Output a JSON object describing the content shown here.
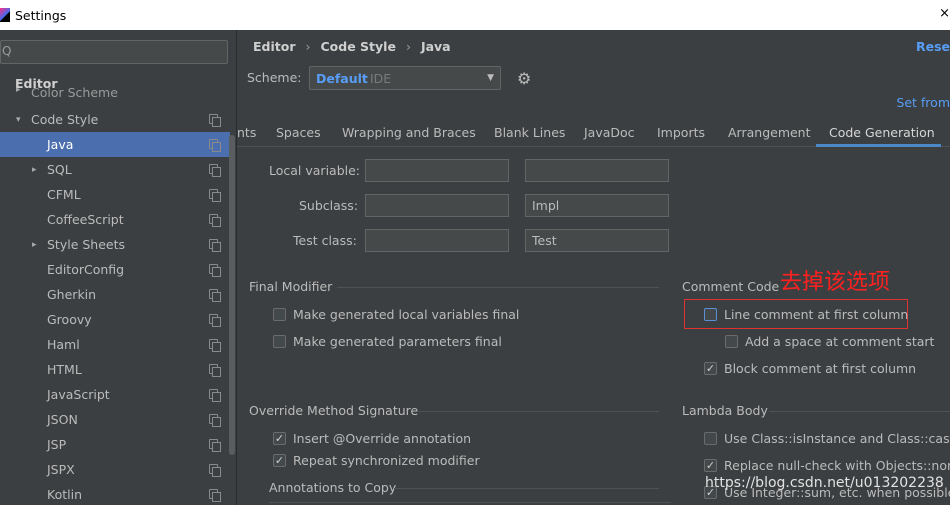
{
  "window": {
    "title": "Settings",
    "close_glyph": "×"
  },
  "sidebar": {
    "search_icon": "Q",
    "search_value": "",
    "section_title": "Editor",
    "items": [
      {
        "label": "Color Scheme",
        "arrow": "▸"
      },
      {
        "label": "Code Style",
        "arrow": "▾"
      },
      {
        "label": "Java",
        "arrow": ""
      },
      {
        "label": "SQL",
        "arrow": "▸"
      },
      {
        "label": "CFML",
        "arrow": ""
      },
      {
        "label": "CoffeeScript",
        "arrow": ""
      },
      {
        "label": "Style Sheets",
        "arrow": "▸"
      },
      {
        "label": "EditorConfig",
        "arrow": ""
      },
      {
        "label": "Gherkin",
        "arrow": ""
      },
      {
        "label": "Groovy",
        "arrow": ""
      },
      {
        "label": "Haml",
        "arrow": ""
      },
      {
        "label": "HTML",
        "arrow": ""
      },
      {
        "label": "JavaScript",
        "arrow": ""
      },
      {
        "label": "JSON",
        "arrow": ""
      },
      {
        "label": "JSP",
        "arrow": ""
      },
      {
        "label": "JSPX",
        "arrow": ""
      },
      {
        "label": "Kotlin",
        "arrow": ""
      }
    ]
  },
  "header": {
    "breadcrumb": [
      "Editor",
      "Code Style",
      "Java"
    ],
    "breadcrumb_sep": "›",
    "reset_label": "Rese",
    "scheme_label": "Scheme:",
    "scheme_value": "Default",
    "scheme_sub": "IDE",
    "scheme_caret": "▼",
    "gear_glyph": "⚙",
    "set_from_label": "Set from"
  },
  "tabs": [
    "nts",
    "Spaces",
    "Wrapping and Braces",
    "Blank Lines",
    "JavaDoc",
    "Imports",
    "Arrangement",
    "Code Generation"
  ],
  "naming": {
    "rows": [
      {
        "label": "Local variable:",
        "prefix": "",
        "suffix": ""
      },
      {
        "label": "Subclass:",
        "prefix": "",
        "suffix": "Impl"
      },
      {
        "label": "Test class:",
        "prefix": "",
        "suffix": "Test"
      }
    ]
  },
  "final_modifier": {
    "title": "Final Modifier",
    "options": [
      {
        "label": "Make generated local variables final",
        "checked": ""
      },
      {
        "label": "Make generated parameters final",
        "checked": ""
      }
    ]
  },
  "comment_code": {
    "title": "Comment Code",
    "options": [
      {
        "label": "Line comment at first column",
        "checked": ""
      },
      {
        "label": "Add a space at comment start",
        "checked": ""
      },
      {
        "label": "Block comment at first column",
        "checked": "✓"
      }
    ],
    "annotation": "去掉该选项"
  },
  "override": {
    "title": "Override Method Signature",
    "options": [
      {
        "label": "Insert @Override annotation",
        "checked": "✓"
      },
      {
        "label": "Repeat synchronized modifier",
        "checked": "✓"
      }
    ],
    "annotations_to_copy": "Annotations to Copy"
  },
  "lambda": {
    "title": "Lambda Body",
    "options": [
      {
        "label": "Use Class::isInstance and Class::cast wh",
        "checked": ""
      },
      {
        "label": "Replace null-check with Objects::nonNu",
        "checked": "✓"
      },
      {
        "label": "Use Integer::sum, etc. when possible",
        "checked": "✓"
      }
    ]
  },
  "watermark": "https://blog.csdn.net/u013202238",
  "colors": {
    "background": "#3c3f41",
    "selection": "#4b6eaf",
    "link": "#589df6",
    "annotation_red": "#ff2020",
    "tab_underline": "#4a88c7"
  }
}
